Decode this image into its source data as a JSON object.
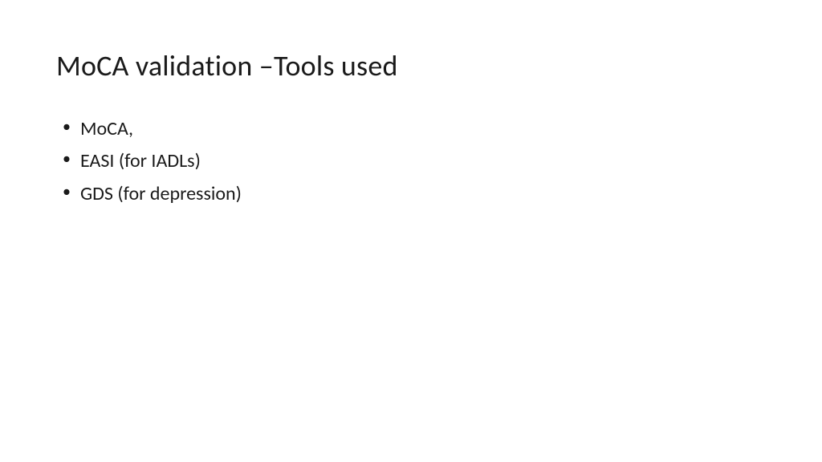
{
  "slide": {
    "title": "MoCA validation –Tools used",
    "bullets": [
      "MoCA,",
      "EASI (for IADLs)",
      "GDS (for depression)"
    ]
  }
}
